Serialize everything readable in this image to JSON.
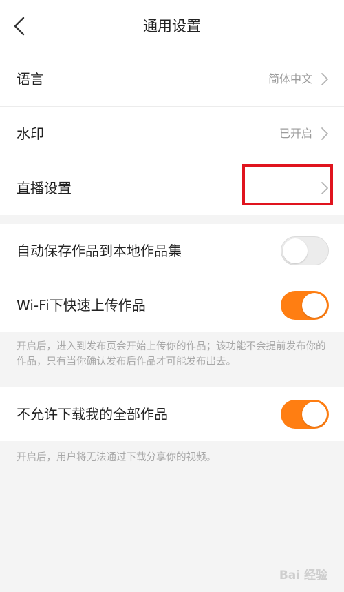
{
  "header": {
    "title": "通用设置"
  },
  "group1": {
    "rows": [
      {
        "label": "语言",
        "value": "简体中文"
      },
      {
        "label": "水印",
        "value": "已开启"
      },
      {
        "label": "直播设置",
        "value": ""
      }
    ]
  },
  "group2": {
    "rows": [
      {
        "label": "自动保存作品到本地作品集",
        "enabled": false
      },
      {
        "label": "Wi-Fi下快速上传作品",
        "enabled": true
      }
    ],
    "note": "开启后，进入到发布页会开始上传你的作品；该功能不会提前发布你的作品，只有当你确认发布后作品才可能发布出去。"
  },
  "group3": {
    "rows": [
      {
        "label": "不允许下载我的全部作品",
        "enabled": true
      }
    ],
    "note": "开启后，用户将无法通过下载分享你的视频。"
  },
  "watermark": {
    "text": "Bai 经验"
  },
  "colors": {
    "accent": "#ff7e12",
    "highlight": "#e0141e"
  },
  "icons": {
    "back": "chevron-left-icon",
    "row_arrow": "chevron-right-icon"
  }
}
